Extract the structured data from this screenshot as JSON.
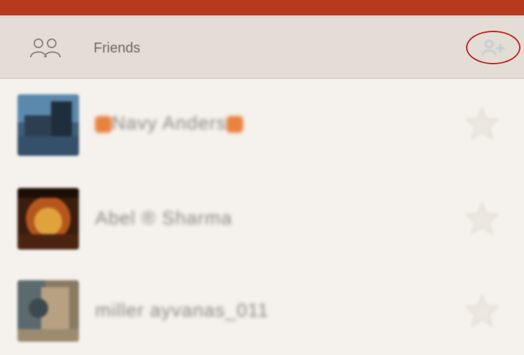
{
  "header": {
    "title": "Friends",
    "icon": "friends-icon",
    "add_icon": "add-friend-icon"
  },
  "colors": {
    "top_bar": "#b83a1e",
    "header_bg": "#e3ddd5",
    "page_bg": "#f5f1ec",
    "highlight_circle": "#c0271f",
    "badge": "#e8823f"
  },
  "friends": [
    {
      "name": "Navy Anders",
      "has_badges": true
    },
    {
      "name": "Abel ® Sharma"
    },
    {
      "name": "miller ayvanas_011"
    }
  ]
}
